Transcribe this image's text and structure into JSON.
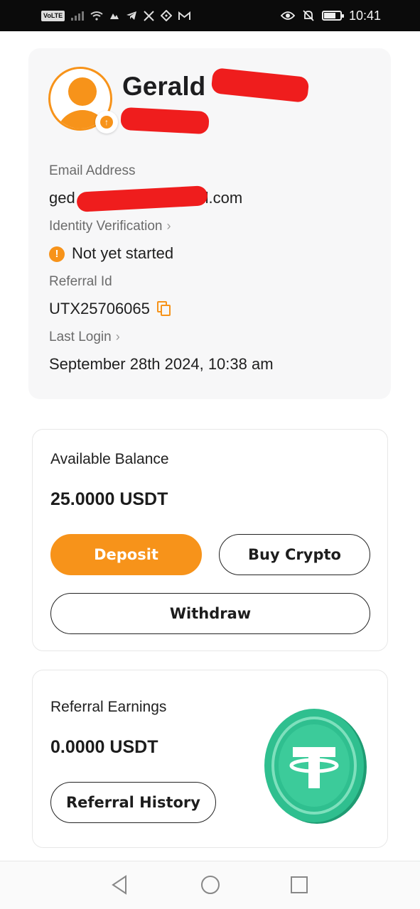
{
  "status_bar": {
    "time": "10:41",
    "left_icons": [
      "volte-icon",
      "signal-icon",
      "wifi-icon",
      "app-icon",
      "telegram-icon",
      "x-icon",
      "binance-icon",
      "gmail-icon"
    ],
    "right_icons": [
      "eye-icon",
      "mute-icon",
      "battery-icon"
    ],
    "volte_label": "VoLTE"
  },
  "profile": {
    "name_line1": "Gerald",
    "email_label": "Email Address",
    "email_prefix": "ged",
    "email_suffix": "il.com",
    "identity_label": "Identity Verification",
    "identity_status": "Not yet started",
    "referral_label": "Referral Id",
    "referral_id": "UTX25706065",
    "last_login_label": "Last Login",
    "last_login_value": "September 28th 2024, 10:38 am"
  },
  "balance": {
    "title": "Available Balance",
    "amount": "25.0000 USDT",
    "deposit_label": "Deposit",
    "buy_label": "Buy Crypto",
    "withdraw_label": "Withdraw"
  },
  "referral": {
    "title": "Referral Earnings",
    "amount": "0.0000 USDT",
    "history_label": "Referral History"
  },
  "colors": {
    "accent": "#f7931a",
    "tether_green": "#2fbf8f",
    "redaction": "#ef1d1d"
  }
}
